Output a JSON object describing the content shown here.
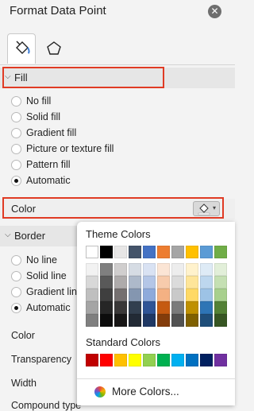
{
  "pane": {
    "title": "Format Data Point"
  },
  "fill": {
    "section_label": "Fill",
    "options": [
      {
        "label": "No fill",
        "checked": false
      },
      {
        "label": "Solid fill",
        "checked": false
      },
      {
        "label": "Gradient fill",
        "checked": false
      },
      {
        "label": "Picture or texture fill",
        "checked": false
      },
      {
        "label": "Pattern fill",
        "checked": false
      },
      {
        "label": "Automatic",
        "checked": true
      }
    ],
    "color_label": "Color"
  },
  "border": {
    "section_label": "Border",
    "options": [
      {
        "label": "No line",
        "checked": false
      },
      {
        "label": "Solid line",
        "checked": false
      },
      {
        "label": "Gradient lin",
        "checked": false
      },
      {
        "label": "Automatic",
        "checked": true
      }
    ],
    "props": [
      "Color",
      "Transparency",
      "Width",
      "Compound type"
    ]
  },
  "palette": {
    "theme_header": "Theme Colors",
    "standard_header": "Standard Colors",
    "more_label": "More Colors...",
    "theme_top": [
      "#ffffff",
      "#000000",
      "#e7e6e6",
      "#44546a",
      "#4472c4",
      "#ed7d31",
      "#a5a5a5",
      "#ffc000",
      "#5b9bd5",
      "#70ad47"
    ],
    "theme_shades": [
      [
        "#f2f2f2",
        "#d8d8d8",
        "#bfbfbf",
        "#a5a5a5",
        "#7f7f7f"
      ],
      [
        "#7f7f7f",
        "#595959",
        "#3f3f3f",
        "#262626",
        "#0c0c0c"
      ],
      [
        "#d0cece",
        "#aeabab",
        "#757070",
        "#3a3838",
        "#171616"
      ],
      [
        "#d6dce4",
        "#adb9ca",
        "#8496b0",
        "#323f4f",
        "#222a35"
      ],
      [
        "#d9e2f3",
        "#b4c6e7",
        "#8eaadb",
        "#2f5496",
        "#1f3864"
      ],
      [
        "#fbe5d5",
        "#f7cbac",
        "#f4b183",
        "#c55a11",
        "#833c0b"
      ],
      [
        "#ededed",
        "#dbdbdb",
        "#c9c9c9",
        "#7b7b7b",
        "#525252"
      ],
      [
        "#fff2cc",
        "#fee599",
        "#ffd965",
        "#bf9000",
        "#7f6000"
      ],
      [
        "#deebf6",
        "#bdd7ee",
        "#9dc3e6",
        "#2e75b5",
        "#1f4e79"
      ],
      [
        "#e2efd9",
        "#c5e0b3",
        "#a8d08d",
        "#538135",
        "#375623"
      ]
    ],
    "standard": [
      "#c00000",
      "#ff0000",
      "#ffc000",
      "#ffff00",
      "#92d050",
      "#00b050",
      "#00b0f0",
      "#0070c0",
      "#002060",
      "#7030a0"
    ]
  }
}
